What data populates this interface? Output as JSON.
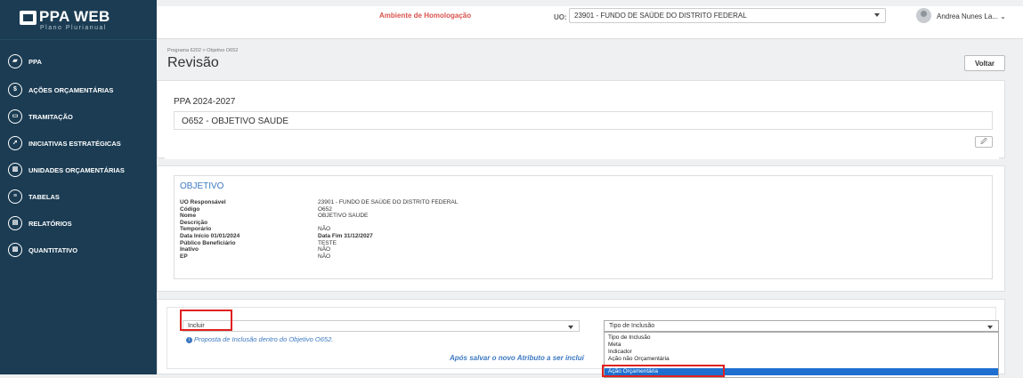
{
  "app": {
    "title": "PPA WEB",
    "subtitle": "Plano Plurianual"
  },
  "sidebar": {
    "items": [
      {
        "label": "PPA",
        "icon": "ppa-icon",
        "glyph": "▰"
      },
      {
        "label": "AÇÕES ORÇAMENTÁRIAS",
        "icon": "dollar-icon",
        "glyph": "$"
      },
      {
        "label": "TRAMITAÇÃO",
        "icon": "inbox-icon",
        "glyph": "▭"
      },
      {
        "label": "INICIATIVAS ESTRATÉGICAS",
        "icon": "rocket-icon",
        "glyph": "➚"
      },
      {
        "label": "UNIDADES ORÇAMENTÁRIAS",
        "icon": "building-icon",
        "glyph": "▥"
      },
      {
        "label": "TABELAS",
        "icon": "table-icon",
        "glyph": "≡"
      },
      {
        "label": "RELATÓRIOS",
        "icon": "report-icon",
        "glyph": "▤"
      },
      {
        "label": "QUANTITATIVO",
        "icon": "chart-icon",
        "glyph": "▨"
      }
    ]
  },
  "header": {
    "environment": "Ambiente de Homologação",
    "uo_label": "UO:",
    "uo_value": "23901 - FUNDO DE SAÚDE DO DISTRITO FEDERAL",
    "user_name": "Andrea Nunes La... ⌄"
  },
  "page": {
    "breadcrumb": "Programa 6202 > Objetivo O652",
    "title": "Revisão",
    "back_button": "Voltar"
  },
  "ppa_card": {
    "period": "PPA 2024-2027",
    "objective": "O652 - OBJETIVO SAUDE",
    "edit_glyph": "🖉"
  },
  "objetivo": {
    "section_title": "OBJETIVO",
    "fields": [
      {
        "label": "UO Responsável",
        "value": "23901 - FUNDO DE SAÚDE DO DISTRITO FEDERAL"
      },
      {
        "label": "Código",
        "value": "O652"
      },
      {
        "label": "Nome",
        "value": "OBJETIVO SAUDE"
      },
      {
        "label": "Descrição",
        "value": ""
      },
      {
        "label": "Temporário",
        "value": "NÃO"
      },
      {
        "label": "Data Início 01/01/2024",
        "value": "Data Fim 31/12/2027"
      },
      {
        "label": "Público Beneficiário",
        "value": "TESTE"
      },
      {
        "label": "Inativo",
        "value": "NÃO"
      },
      {
        "label": "EP",
        "value": "NÃO"
      }
    ]
  },
  "inclusion": {
    "action_select": "Incluir",
    "info_text": "Proposta de Inclusão dentro do Objetivo O652.",
    "after_save_text": "Após salvar o novo Atributo a ser incluí",
    "type_select": "Tipo de Inclusão",
    "type_options": [
      "Tipo de Inclusão",
      "Meta",
      "Indicador",
      "Ação não Orçamentária",
      "Ação Orçamentária"
    ],
    "selected_option": "Ação Orçamentária"
  }
}
